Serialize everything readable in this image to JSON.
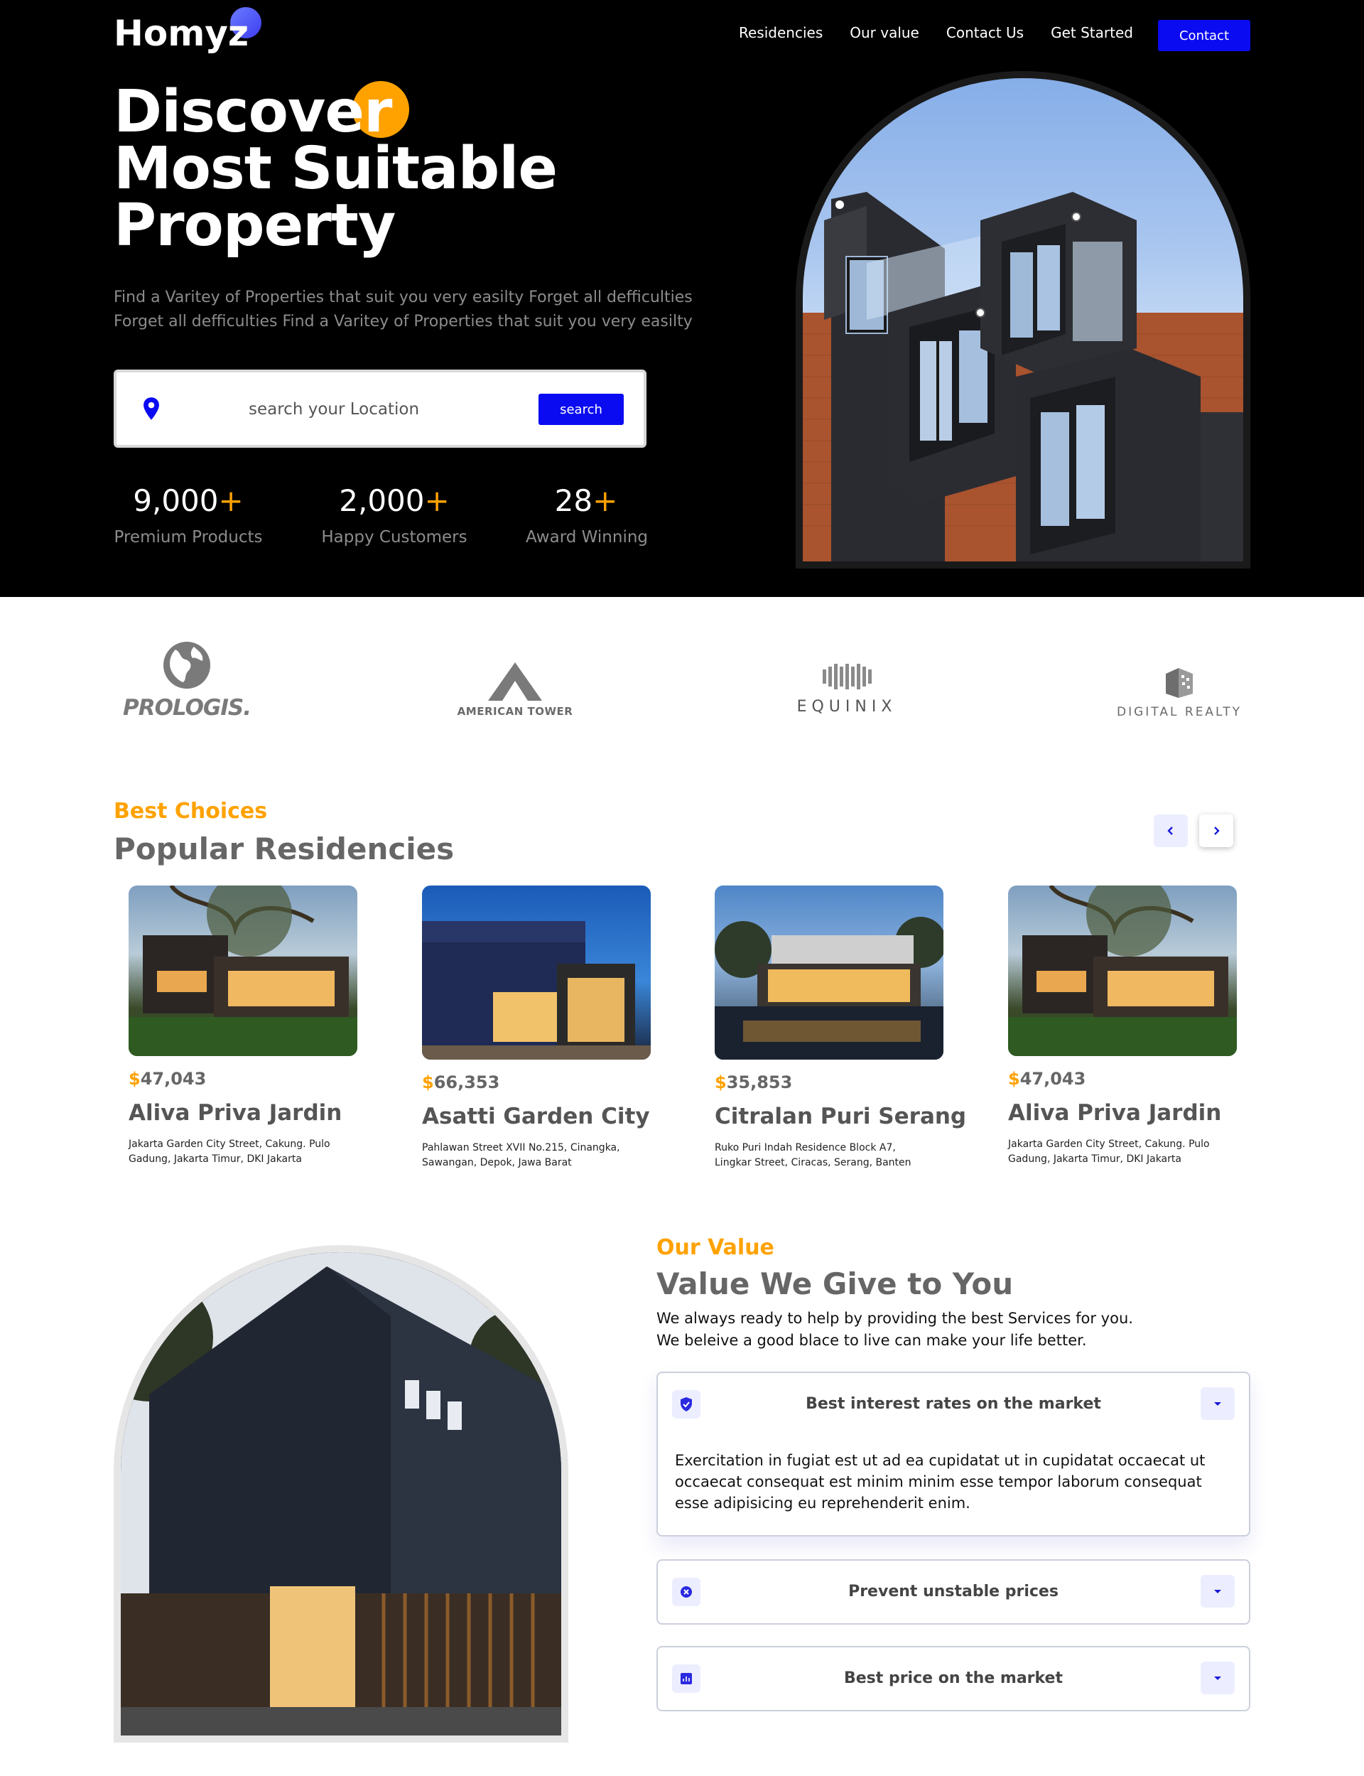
{
  "header": {
    "logo": "Homyz",
    "nav": [
      "Residencies",
      "Our value",
      "Contact Us",
      "Get Started"
    ],
    "contact_button": "Contact"
  },
  "hero": {
    "title_lines": [
      "Discover",
      "Most Suitable",
      "Property"
    ],
    "description_lines": [
      "Find a Varitey of Properties that suit you very easilty Forget all defficulties",
      "Forget all defficulties Find a Varitey of Properties that suit you very easilty"
    ],
    "search": {
      "placeholder": "search your Location",
      "button": "search"
    },
    "stats": [
      {
        "value": "9,000",
        "suffix": "+",
        "label": "Premium Products"
      },
      {
        "value": "2,000",
        "suffix": "+",
        "label": "Happy Customers"
      },
      {
        "value": "28",
        "suffix": "+",
        "label": "Award Winning"
      }
    ]
  },
  "brands": [
    "PROLOGIS.",
    "AMERICAN TOWER",
    "EQUINIX",
    "DIGITAL REALTY"
  ],
  "residencies": {
    "eyebrow": "Best Choices",
    "title": "Popular Residencies",
    "prev_icon": "chevron-left-icon",
    "next_icon": "chevron-right-icon",
    "currency": "$",
    "cards": [
      {
        "price": "47,043",
        "name": "Aliva Priva Jardin",
        "address": "Jakarta Garden City Street, Cakung. Pulo Gadung, Jakarta Timur, DKI Jakarta"
      },
      {
        "price": "66,353",
        "name": "Asatti Garden City",
        "address": "Pahlawan Street XVII No.215, Cinangka, Sawangan, Depok, Jawa Barat"
      },
      {
        "price": "35,853",
        "name": "Citralan Puri Serang",
        "address": "Ruko Puri Indah Residence Block A7, Lingkar Street, Ciracas, Serang, Banten"
      },
      {
        "price": "47,043",
        "name": "Aliva Priva Jardin",
        "address": "Jakarta Garden City Street, Cakung. Pulo Gadung, Jakarta Timur, DKI Jakarta"
      }
    ]
  },
  "value": {
    "eyebrow": "Our Value",
    "title": "Value We Give to You",
    "description_lines": [
      "We always ready to help by providing the best Services for you.",
      "We beleive a good blace to live can make your life better."
    ],
    "items": [
      {
        "title": "Best interest rates on the market",
        "icon": "shield-check-icon",
        "expanded": true,
        "body": "Exercitation in fugiat est ut ad ea cupidatat ut in cupidatat occaecat ut occaecat consequat est minim minim esse tempor laborum consequat esse adipisicing eu reprehenderit enim."
      },
      {
        "title": "Prevent unstable prices",
        "icon": "cancel-circle-icon",
        "expanded": false
      },
      {
        "title": "Best price on the market",
        "icon": "analytics-icon",
        "expanded": false
      }
    ]
  },
  "colors": {
    "accent": "#ffa200",
    "primary": "#0b0bf2",
    "hero_bg": "#000000",
    "muted": "#8c8c8c"
  }
}
